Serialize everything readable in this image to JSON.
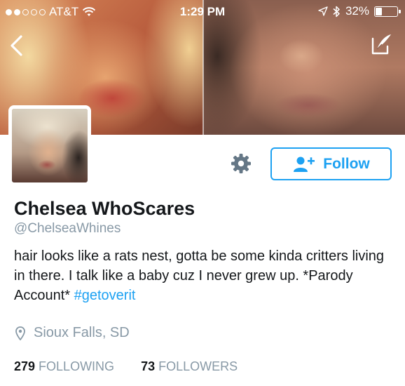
{
  "status_bar": {
    "carrier": "AT&T",
    "time": "1:29 PM",
    "battery_percent": "32%",
    "battery_level": 0.32,
    "signal_dots_filled": 2,
    "signal_dots_total": 5
  },
  "header": {
    "back_icon": "chevron-left-icon",
    "compose_icon": "compose-feather-icon"
  },
  "actions": {
    "settings_icon": "gear-icon",
    "follow_label": "Follow",
    "follow_icon": "add-user-icon"
  },
  "profile": {
    "name": "Chelsea WhoScares",
    "handle": "@ChelseaWhines",
    "bio_text": "hair looks like a rats nest, gotta be some kinda critters living in there. I talk like a baby cuz I never grew up. *Parody Account* ",
    "bio_hashtag": "#getoverit",
    "location": "Sioux Falls, SD",
    "location_icon": "location-pin-icon"
  },
  "stats": {
    "following_count": "279",
    "following_label": "FOLLOWING",
    "followers_count": "73",
    "followers_label": "FOLLOWERS"
  },
  "colors": {
    "accent": "#1da1f2",
    "secondary_text": "#8899a6",
    "primary_text": "#14171a"
  }
}
